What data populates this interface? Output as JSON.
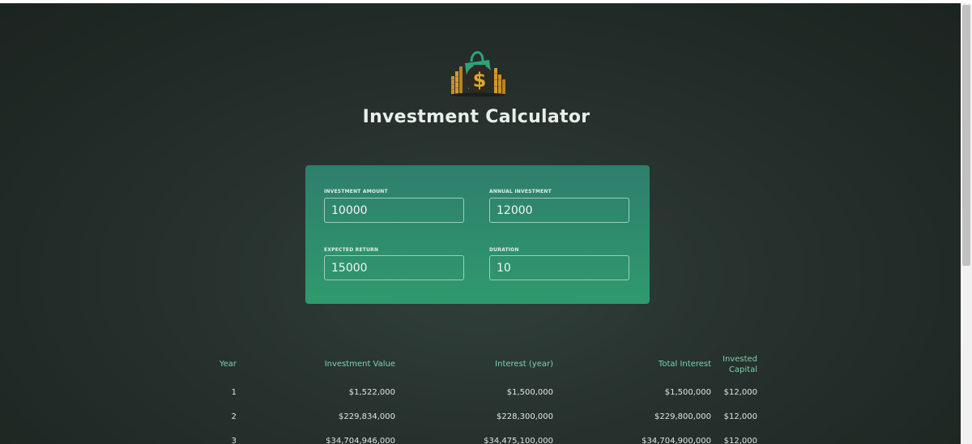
{
  "header": {
    "title": "Investment Calculator"
  },
  "form": {
    "fields": [
      {
        "label": "INVESTMENT AMOUNT",
        "value": "10000"
      },
      {
        "label": "ANNUAL INVESTMENT",
        "value": "12000"
      },
      {
        "label": "EXPECTED RETURN",
        "value": "15000"
      },
      {
        "label": "DURATION",
        "value": "10"
      }
    ]
  },
  "results": {
    "columns": [
      "Year",
      "Investment Value",
      "Interest (year)",
      "Total Interest",
      "Invested\nCapital"
    ],
    "rows": [
      [
        "1",
        "$1,522,000",
        "$1,500,000",
        "$1,500,000",
        "$12,000"
      ],
      [
        "2",
        "$229,834,000",
        "$228,300,000",
        "$229,800,000",
        "$12,000"
      ],
      [
        "3",
        "$34,704,946,000",
        "$34,475,100,000",
        "$34,704,900,000",
        "$12,000"
      ]
    ]
  },
  "colors": {
    "panel": "#2f8a6d",
    "accent": "#7fd1b0",
    "background": "#26302c"
  },
  "icons": {
    "logo": "money-bag-icon"
  }
}
